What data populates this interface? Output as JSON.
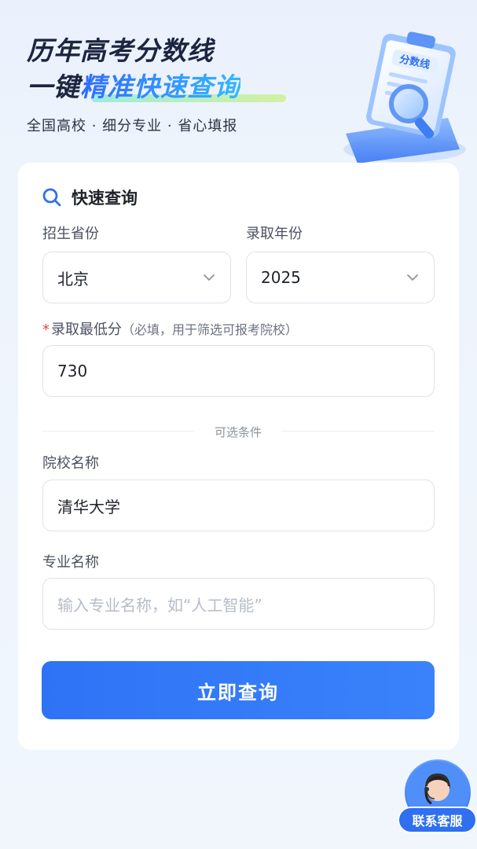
{
  "hero": {
    "title_line1": "历年高考分数线",
    "title_line2_plain": "一键",
    "title_line2_accent": "精准快速查询",
    "subtitle": "全国高校 · 细分专业 · 省心填报",
    "badge_text": "分数线",
    "illustration_icon": "clipboard-magnifier-icon"
  },
  "form": {
    "title": "快速查询",
    "title_icon": "search-icon",
    "province": {
      "label": "招生省份",
      "value": "北京"
    },
    "year": {
      "label": "录取年份",
      "value": "2025"
    },
    "min_score": {
      "required_mark": "*",
      "label": "录取最低分",
      "hint": "（必填，用于筛选可报考院校）",
      "value": "730"
    },
    "optional_divider": "可选条件",
    "school": {
      "label": "院校名称",
      "value": "清华大学"
    },
    "major": {
      "label": "专业名称",
      "value": "",
      "placeholder": "输入专业名称，如“人工智能”"
    },
    "submit_label": "立即查询"
  },
  "service": {
    "label": "联系客服",
    "icon": "customer-service-avatar"
  },
  "colors": {
    "accent": "#2f6ff0",
    "required": "#e8423b",
    "background": "#eef4fc"
  }
}
